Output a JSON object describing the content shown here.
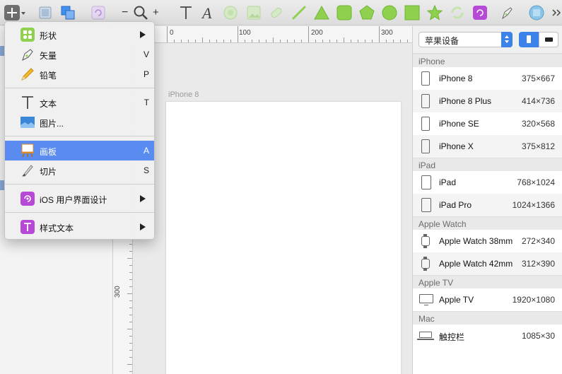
{
  "toolbar": {
    "items": [
      "insert-icon",
      "group-icon",
      "combine-icon",
      "rotate-copies-icon",
      "zoom-out-icon",
      "zoom-icon",
      "zoom-in-icon",
      "text-icon",
      "typography-icon",
      "oval-icon",
      "image-icon",
      "slice-icon",
      "line-icon",
      "triangle-icon",
      "rounded-rect-icon",
      "pentagon-icon",
      "circle-icon",
      "rectangle-icon",
      "star-icon",
      "refresh-icon",
      "symbol-icon",
      "pen-icon",
      "mirror-icon",
      "more-icon"
    ],
    "zoom_out": "−",
    "zoom_in": "+"
  },
  "menu": {
    "items": [
      {
        "label": "形状",
        "key": "",
        "submenu": true
      },
      {
        "label": "矢量",
        "key": "V",
        "submenu": false
      },
      {
        "label": "铅笔",
        "key": "P",
        "submenu": false
      },
      {
        "label": "文本",
        "key": "T",
        "submenu": false
      },
      {
        "label": "图片...",
        "key": "",
        "submenu": false
      },
      {
        "label": "画板",
        "key": "A",
        "submenu": false,
        "highlighted": true
      },
      {
        "label": "切片",
        "key": "S",
        "submenu": false
      },
      {
        "label": "iOS 用户界面设计",
        "key": "",
        "submenu": true
      },
      {
        "label": "样式文本",
        "key": "",
        "submenu": true
      }
    ]
  },
  "ruler": {
    "top_labels": [
      "0",
      "100",
      "200",
      "300"
    ],
    "left_labels": [
      "300"
    ]
  },
  "canvas": {
    "artboard_title": "iPhone 8"
  },
  "inspector": {
    "preset": "苹果设备",
    "sections": [
      {
        "title": "iPhone",
        "devices": [
          {
            "name": "iPhone 8",
            "size": "375×667"
          },
          {
            "name": "iPhone 8 Plus",
            "size": "414×736"
          },
          {
            "name": "iPhone SE",
            "size": "320×568"
          },
          {
            "name": "iPhone X",
            "size": "375×812"
          }
        ]
      },
      {
        "title": "iPad",
        "devices": [
          {
            "name": "iPad",
            "size": "768×1024"
          },
          {
            "name": "iPad Pro",
            "size": "1024×1366"
          }
        ]
      },
      {
        "title": "Apple Watch",
        "devices": [
          {
            "name": "Apple Watch 38mm",
            "size": "272×340"
          },
          {
            "name": "Apple Watch 42mm",
            "size": "312×390"
          }
        ]
      },
      {
        "title": "Apple TV",
        "devices": [
          {
            "name": "Apple TV",
            "size": "1920×1080"
          }
        ]
      },
      {
        "title": "Mac",
        "devices": [
          {
            "name": "触控栏",
            "size": "1085×30"
          }
        ]
      }
    ]
  },
  "colors": {
    "accent": "#3d82ea",
    "menu_highlight": "#5a8bf0",
    "shape_green": "#8fd14f",
    "symbol_purple": "#b649d6"
  }
}
